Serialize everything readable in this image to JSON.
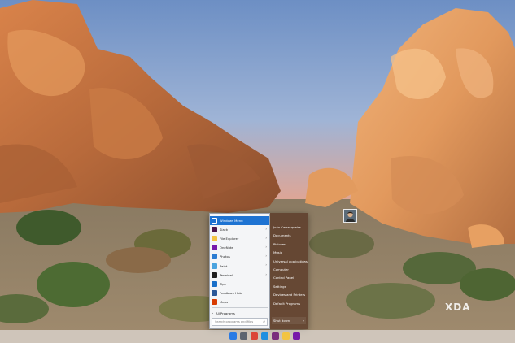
{
  "start_menu": {
    "pinned": [
      {
        "label": "Windows Menu",
        "icon": "windows-menu-icon",
        "color": "#ffffff",
        "highlight": true,
        "arrow": ""
      },
      {
        "label": "Slack",
        "icon": "slack-icon",
        "color": "#4a154b",
        "highlight": false,
        "arrow": "›"
      },
      {
        "label": "File Explorer",
        "icon": "folder-icon",
        "color": "#f3c443",
        "highlight": false,
        "arrow": "›"
      },
      {
        "label": "OneNote",
        "icon": "onenote-icon",
        "color": "#7719aa",
        "highlight": false,
        "arrow": "›"
      },
      {
        "label": "Photos",
        "icon": "photos-icon",
        "color": "#2d7dd2",
        "highlight": false,
        "arrow": "›"
      },
      {
        "label": "Paint",
        "icon": "paint-icon",
        "color": "#4aa3df",
        "highlight": false,
        "arrow": "›"
      },
      {
        "label": "Terminal",
        "icon": "terminal-icon",
        "color": "#1f1f1f",
        "highlight": false,
        "arrow": "›"
      },
      {
        "label": "Tips",
        "icon": "tips-icon",
        "color": "#1a6fc9",
        "highlight": false,
        "arrow": ""
      },
      {
        "label": "Feedback Hub",
        "icon": "feedback-hub-icon",
        "color": "#2b5797",
        "highlight": false,
        "arrow": ""
      },
      {
        "label": "Maps",
        "icon": "maps-icon",
        "color": "#d83b01",
        "highlight": false,
        "arrow": ""
      }
    ],
    "all_programs": "All Programs",
    "search_placeholder": "Search programs and files",
    "right_items": [
      {
        "label": "João Carrasqueira",
        "sub": ""
      },
      {
        "label": "Documents",
        "sub": ""
      },
      {
        "label": "Pictures",
        "sub": ""
      },
      {
        "label": "Music",
        "sub": ""
      },
      {
        "label": "Universal applications",
        "sub": "›"
      },
      {
        "label": "Computer",
        "sub": ""
      },
      {
        "label": "Control Panel",
        "sub": ""
      },
      {
        "label": "Settings",
        "sub": ""
      },
      {
        "label": "Devices and Printers",
        "sub": ""
      },
      {
        "label": "Default Programs",
        "sub": ""
      }
    ],
    "shutdown": {
      "label": "Shut down",
      "sub": "›"
    }
  },
  "taskbar": {
    "icons": [
      {
        "name": "start-button-icon",
        "color": "#2b7be4"
      },
      {
        "name": "task-view-icon",
        "color": "#5c6470"
      },
      {
        "name": "chrome-icon",
        "color": "#db4437"
      },
      {
        "name": "edge-icon",
        "color": "#1f8fe0"
      },
      {
        "name": "slack-icon",
        "color": "#7a2c7d"
      },
      {
        "name": "file-explorer-icon",
        "color": "#f3c443"
      },
      {
        "name": "onenote-icon",
        "color": "#7719aa"
      }
    ]
  },
  "watermark": "XDA"
}
